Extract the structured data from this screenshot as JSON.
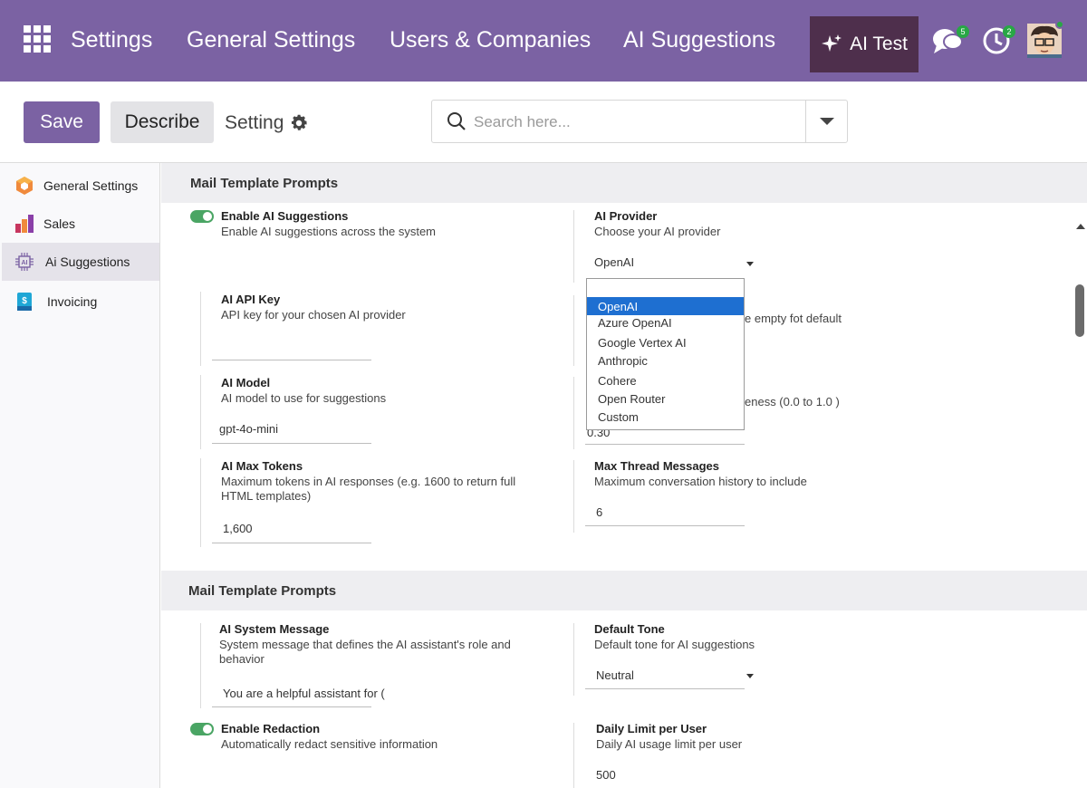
{
  "topbar": {
    "menu": [
      "Settings",
      "General Settings",
      "Users & Companies",
      "AI Suggestions"
    ],
    "ai_test_label": "AI Test",
    "chat_badge": "5",
    "activity_badge": "2"
  },
  "control": {
    "save_label": "Save",
    "describe_label": "Describe",
    "setting_label": "Setting",
    "search_placeholder": "Search here..."
  },
  "sidebar": {
    "items": [
      {
        "label": "General Settings",
        "icon": "hexagon-icon"
      },
      {
        "label": "Sales",
        "icon": "bar-chart-icon"
      },
      {
        "label": "Ai Suggestions",
        "icon": "ai-icon"
      },
      {
        "label": "Invoicing",
        "icon": "invoice-icon"
      }
    ]
  },
  "sections": [
    {
      "title": "Mail Template Prompts"
    },
    {
      "title": "Mail Template Prompts"
    }
  ],
  "settings": {
    "enable_ai": {
      "title": "Enable AI Suggestions",
      "desc": "Enable AI suggestions across the system"
    },
    "provider": {
      "title": "AI Provider",
      "desc": "Choose your AI provider",
      "value": "OpenAI"
    },
    "api_key": {
      "title": "AI API Key",
      "desc": "API key for your chosen AI provider"
    },
    "endpoint_hint": "e empty  fot default",
    "model": {
      "title": "AI Model",
      "desc": "AI model to use for suggestions",
      "value": "gpt-4o-mini"
    },
    "temperature_hint": "eness (0.0 to 1.0 )",
    "temperature_value": "0.30",
    "max_tokens": {
      "title": "AI Max Tokens",
      "desc": "Maximum tokens in AI responses (e.g. 1600 to return full HTML templates)",
      "value": "1,600"
    },
    "max_thread": {
      "title": "Max Thread Messages",
      "desc": "Maximum conversation history to include",
      "value": "6"
    },
    "system_message": {
      "title": "AI System Message",
      "desc": "System message that defines the AI assistant's role and behavior",
      "value": "You are a helpful assistant for ("
    },
    "default_tone": {
      "title": "Default Tone",
      "desc": "Default tone for AI suggestions",
      "value": "Neutral"
    },
    "redaction": {
      "title": "Enable Redaction",
      "desc": "Automatically redact sensitive information"
    },
    "daily_limit": {
      "title": "Daily Limit per User",
      "desc": "Daily AI usage limit per user",
      "value": "500"
    }
  },
  "provider_options": [
    "OpenAI",
    "Azure OpenAI",
    "Google Vertex AI",
    "Anthropic",
    "Cohere",
    "Open Router",
    "Custom"
  ],
  "colors": {
    "brand": "#7b62a3",
    "ai_test_bg": "#4e2f4c",
    "toggle_on": "#4aa564",
    "selected_option": "#1e6fd1"
  }
}
